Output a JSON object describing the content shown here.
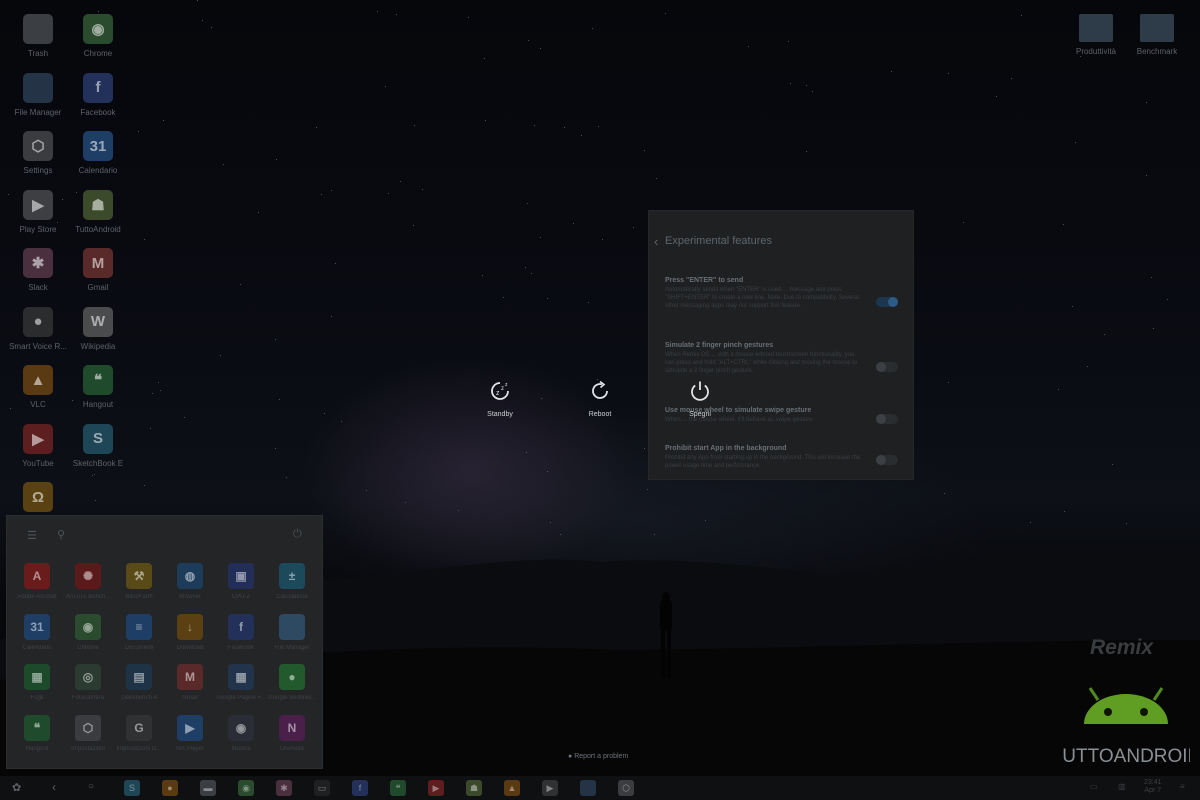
{
  "desktop_left": [
    {
      "label": "Trash",
      "icon": "trash-icon",
      "color": "#3b3e42",
      "glyph": ""
    },
    {
      "label": "Chrome",
      "icon": "chrome-icon",
      "color": "#2a4b2d",
      "glyph": "◉"
    },
    {
      "label": "File Manager",
      "icon": "folder-icon",
      "color": "#243446",
      "glyph": ""
    },
    {
      "label": "Facebook",
      "icon": "facebook-icon",
      "color": "#23305a",
      "glyph": "f"
    },
    {
      "label": "Settings",
      "icon": "gear-icon",
      "color": "#3a3c3f",
      "glyph": "⬡"
    },
    {
      "label": "Calendario",
      "icon": "calendar-icon",
      "color": "#1f3e66",
      "glyph": "31"
    },
    {
      "label": "Play Store",
      "icon": "play-store-icon",
      "color": "#3d3f42",
      "glyph": "▶"
    },
    {
      "label": "TuttoAndroid",
      "icon": "android-icon",
      "color": "#3c4a2c",
      "glyph": "☗"
    },
    {
      "label": "Slack",
      "icon": "slack-icon",
      "color": "#4a2f3e",
      "glyph": "✱"
    },
    {
      "label": "Gmail",
      "icon": "gmail-icon",
      "color": "#5a2a2a",
      "glyph": "M"
    },
    {
      "label": "Smart Voice R...",
      "icon": "microphone-icon",
      "color": "#2a2c2e",
      "glyph": "●"
    },
    {
      "label": "Wikipedia",
      "icon": "wikipedia-icon",
      "color": "#4a4b4c",
      "glyph": "W"
    },
    {
      "label": "VLC",
      "icon": "vlc-icon",
      "color": "#5a3a12",
      "glyph": "▲"
    },
    {
      "label": "Hangout",
      "icon": "hangouts-icon",
      "color": "#1f4a2c",
      "glyph": "❝"
    },
    {
      "label": "YouTube",
      "icon": "youtube-icon",
      "color": "#5c1e1e",
      "glyph": "▶"
    },
    {
      "label": "SketchBook E",
      "icon": "sketchbook-icon",
      "color": "#1f4656",
      "glyph": "S"
    },
    {
      "label": "",
      "icon": "headphones-icon",
      "color": "#5a4112",
      "glyph": "Ω"
    }
  ],
  "desktop_right": [
    {
      "label": "Produttività",
      "icon": "folder-icon"
    },
    {
      "label": "Benchmark",
      "icon": "folder-icon"
    }
  ],
  "settings": {
    "title": "Experimental features",
    "items": [
      {
        "heading": "Press \"ENTER\" to send",
        "desc": "Automatically sends when \"ENTER\" is used ... message and press \"SHIFT+ENTER\" to create a new line. Note: Due to compatibility, Several other messaging apps may not support this feature.",
        "on": true
      },
      {
        "heading": "Simulate 2 finger pinch gestures",
        "desc": "When Remix OS ... with a mouse without touchscreen functionality, you can press and hold \"ALT+CTRL\" while clicking and moving the mouse to simulate a 2 finger pinch gesture.",
        "on": false
      },
      {
        "heading": "Use mouse wheel to simulate swipe gesture",
        "desc": "When ... the mouse wheel, it'll behave as swipe gesture",
        "on": false
      },
      {
        "heading": "Prohibit start App in the background",
        "desc": "Prohibit any App from starting up in the background. This will increase the power usage time and performance.",
        "on": false
      }
    ]
  },
  "power_menu": [
    {
      "label": "Standby",
      "icon": "sleep-icon"
    },
    {
      "label": "Reboot",
      "icon": "reboot-icon"
    },
    {
      "label": "Spegni",
      "icon": "power-icon"
    }
  ],
  "start_menu": {
    "apps": [
      {
        "label": "Adobe Acrobat",
        "icon": "acrobat-icon",
        "color": "#6a1c1c",
        "glyph": "A"
      },
      {
        "label": "AnTuTu Bench...",
        "icon": "antutu-icon",
        "color": "#5a1a1a",
        "glyph": "✺"
      },
      {
        "label": "BitcoFarm",
        "icon": "bitcofarm-icon",
        "color": "#5a4a18",
        "glyph": "⚒"
      },
      {
        "label": "Browser",
        "icon": "browser-icon",
        "color": "#1c3c5a",
        "glyph": "◍"
      },
      {
        "label": "CPU-Z",
        "icon": "cpu-z-icon",
        "color": "#232e58",
        "glyph": "▣"
      },
      {
        "label": "Calcolatrice",
        "icon": "calculator-icon",
        "color": "#1c4a5a",
        "glyph": "±"
      },
      {
        "label": "Calendario",
        "icon": "calendar-icon",
        "color": "#1f3e66",
        "glyph": "31"
      },
      {
        "label": "Chrome",
        "icon": "chrome-icon",
        "color": "#2a4b2d",
        "glyph": "◉"
      },
      {
        "label": "Documenti",
        "icon": "docs-icon",
        "color": "#1f3e66",
        "glyph": "≡"
      },
      {
        "label": "Download",
        "icon": "download-icon",
        "color": "#5a4012",
        "glyph": "↓"
      },
      {
        "label": "Facebook",
        "icon": "facebook-icon",
        "color": "#23305a",
        "glyph": "f"
      },
      {
        "label": "File Manager",
        "icon": "folder-icon",
        "color": "#2e4a62",
        "glyph": ""
      },
      {
        "label": "Fogli",
        "icon": "sheets-icon",
        "color": "#1d4a2b",
        "glyph": "▦"
      },
      {
        "label": "Fotocamera",
        "icon": "camera-icon",
        "color": "#2b3b32",
        "glyph": "◎"
      },
      {
        "label": "Geekbench 4",
        "icon": "geekbench-icon",
        "color": "#1f3346",
        "glyph": "▤"
      },
      {
        "label": "Gmail",
        "icon": "gmail-icon",
        "color": "#5a2a2a",
        "glyph": "M"
      },
      {
        "label": "Google Pagine F...",
        "icon": "google-pages-icon",
        "color": "#22344c",
        "glyph": "▦"
      },
      {
        "label": "Google Sentinel...",
        "icon": "google-sentinel-icon",
        "color": "#225a2e",
        "glyph": "●"
      },
      {
        "label": "Hangout",
        "icon": "hangouts-icon",
        "color": "#1f4a2c",
        "glyph": "❝"
      },
      {
        "label": "Impostazioni",
        "icon": "gear-icon",
        "color": "#3a3c3f",
        "glyph": "⬡"
      },
      {
        "label": "Impostazioni G...",
        "icon": "google-settings-icon",
        "color": "#2f3133",
        "glyph": "G"
      },
      {
        "label": "MX Player",
        "icon": "mx-player-icon",
        "color": "#1f3e66",
        "glyph": "▶"
      },
      {
        "label": "Musica",
        "icon": "music-icon",
        "color": "#2a2c36",
        "glyph": "◉"
      },
      {
        "label": "OneNote",
        "icon": "onenote-icon",
        "color": "#4a1f4a",
        "glyph": "N"
      }
    ]
  },
  "taskbar": {
    "items": [
      {
        "icon": "sketchbook-icon",
        "color": "#1f4656",
        "glyph": "S"
      },
      {
        "icon": "orange-app-icon",
        "color": "#5a3a12",
        "glyph": "●"
      },
      {
        "icon": "briefcase-icon",
        "color": "#3b3e42",
        "glyph": "▬"
      },
      {
        "icon": "chrome-icon",
        "color": "#2a4b2d",
        "glyph": "◉"
      },
      {
        "icon": "slack-icon",
        "color": "#4a2f3e",
        "glyph": "✱"
      },
      {
        "icon": "photo-icon",
        "color": "#1f2022",
        "glyph": "▭"
      },
      {
        "icon": "facebook-icon",
        "color": "#23305a",
        "glyph": "f"
      },
      {
        "icon": "hangouts-icon",
        "color": "#1f4a2c",
        "glyph": "❝"
      },
      {
        "icon": "youtube-icon",
        "color": "#5c1e1e",
        "glyph": "▶"
      },
      {
        "icon": "android-icon",
        "color": "#3c4a2c",
        "glyph": "☗"
      },
      {
        "icon": "vlc-icon",
        "color": "#5a3a12",
        "glyph": "▲"
      },
      {
        "icon": "play-store-icon",
        "color": "#2f3133",
        "glyph": "▶"
      },
      {
        "icon": "folder-icon",
        "color": "#243446",
        "glyph": ""
      },
      {
        "icon": "gear-icon",
        "color": "#3a3c3f",
        "glyph": "⬡"
      }
    ],
    "clock": "23:41",
    "date": "Apr 7"
  },
  "report_problem": "Report a problem",
  "watermark": {
    "remix": "Remix",
    "brand": "TUTTOANDROID"
  }
}
